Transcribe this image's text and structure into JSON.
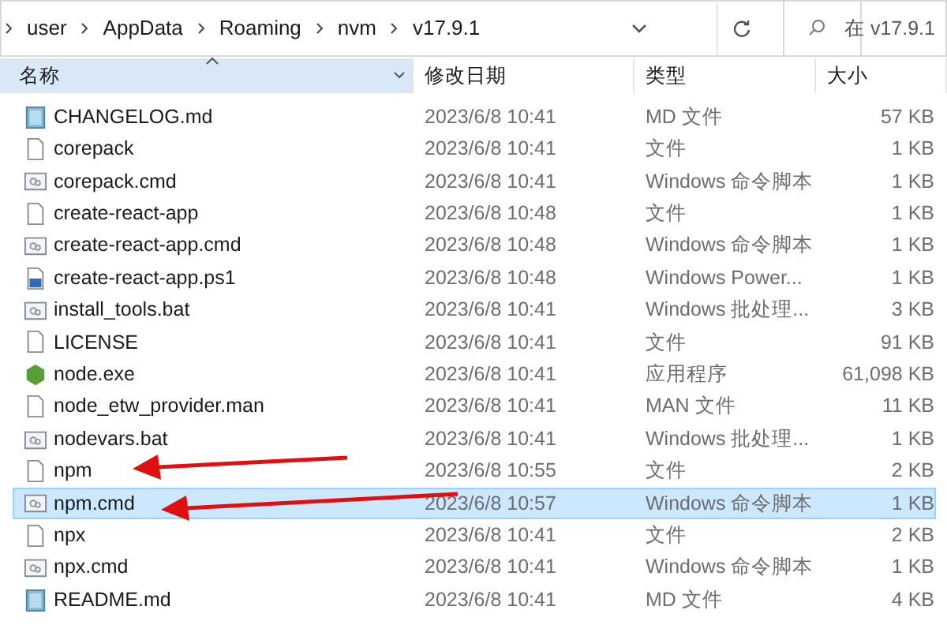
{
  "address_bar": {
    "breadcrumbs": [
      "user",
      "AppData",
      "Roaming",
      "nvm",
      "v17.9.1"
    ]
  },
  "search": {
    "placeholder": "在 v17.9.1"
  },
  "table": {
    "columns": [
      {
        "label": "名称",
        "sorted": true
      },
      {
        "label": "修改日期",
        "sorted": false
      },
      {
        "label": "类型",
        "sorted": false
      },
      {
        "label": "大小",
        "sorted": false
      }
    ],
    "rows": [
      {
        "kind": "md",
        "name": "CHANGELOG.md",
        "date": "2023/6/8 10:41",
        "type": "MD 文件",
        "size": "57 KB",
        "selected": false
      },
      {
        "kind": "file",
        "name": "corepack",
        "date": "2023/6/8 10:41",
        "type": "文件",
        "size": "1 KB",
        "selected": false
      },
      {
        "kind": "script",
        "name": "corepack.cmd",
        "date": "2023/6/8 10:41",
        "type": "Windows 命令脚本",
        "size": "1 KB",
        "selected": false
      },
      {
        "kind": "file",
        "name": "create-react-app",
        "date": "2023/6/8 10:48",
        "type": "文件",
        "size": "1 KB",
        "selected": false
      },
      {
        "kind": "script",
        "name": "create-react-app.cmd",
        "date": "2023/6/8 10:48",
        "type": "Windows 命令脚本",
        "size": "1 KB",
        "selected": false
      },
      {
        "kind": "ps1",
        "name": "create-react-app.ps1",
        "date": "2023/6/8 10:48",
        "type": "Windows Power...",
        "size": "1 KB",
        "selected": false
      },
      {
        "kind": "script",
        "name": "install_tools.bat",
        "date": "2023/6/8 10:41",
        "type": "Windows 批处理...",
        "size": "3 KB",
        "selected": false
      },
      {
        "kind": "file",
        "name": "LICENSE",
        "date": "2023/6/8 10:41",
        "type": "文件",
        "size": "91 KB",
        "selected": false
      },
      {
        "kind": "exe",
        "name": "node.exe",
        "date": "2023/6/8 10:41",
        "type": "应用程序",
        "size": "61,098 KB",
        "selected": false
      },
      {
        "kind": "file",
        "name": "node_etw_provider.man",
        "date": "2023/6/8 10:41",
        "type": "MAN 文件",
        "size": "11 KB",
        "selected": false
      },
      {
        "kind": "script",
        "name": "nodevars.bat",
        "date": "2023/6/8 10:41",
        "type": "Windows 批处理...",
        "size": "1 KB",
        "selected": false
      },
      {
        "kind": "file",
        "name": "npm",
        "date": "2023/6/8 10:55",
        "type": "文件",
        "size": "2 KB",
        "selected": false
      },
      {
        "kind": "script",
        "name": "npm.cmd",
        "date": "2023/6/8 10:57",
        "type": "Windows 命令脚本",
        "size": "1 KB",
        "selected": true
      },
      {
        "kind": "file",
        "name": "npx",
        "date": "2023/6/8 10:41",
        "type": "文件",
        "size": "2 KB",
        "selected": false
      },
      {
        "kind": "script",
        "name": "npx.cmd",
        "date": "2023/6/8 10:41",
        "type": "Windows 命令脚本",
        "size": "1 KB",
        "selected": false
      },
      {
        "kind": "md",
        "name": "README.md",
        "date": "2023/6/8 10:41",
        "type": "MD 文件",
        "size": "4 KB",
        "selected": false
      }
    ]
  }
}
